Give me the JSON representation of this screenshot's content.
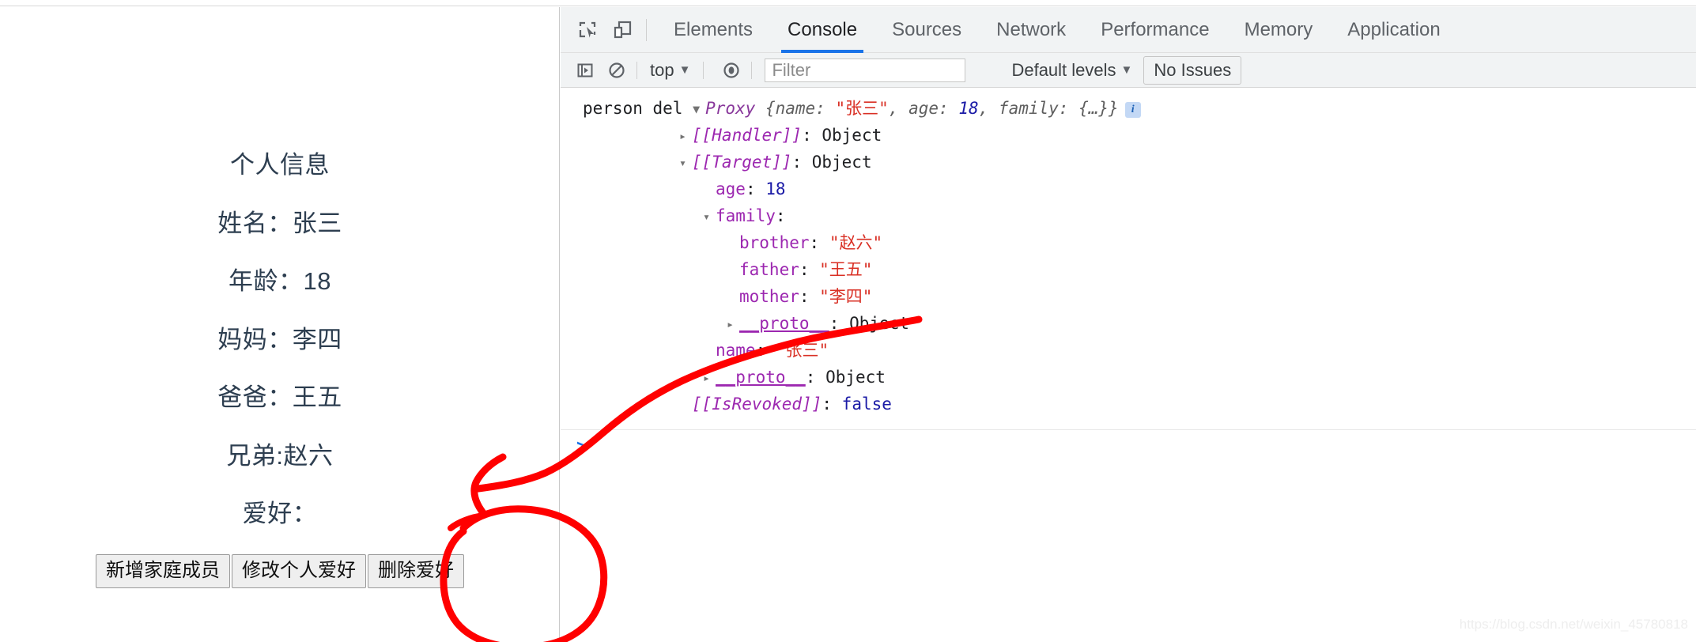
{
  "webpage": {
    "title": "个人信息",
    "lines": [
      {
        "key": "name",
        "text": "姓名：张三"
      },
      {
        "key": "age",
        "text": "年龄：18"
      },
      {
        "key": "mother",
        "text": "妈妈：李四"
      },
      {
        "key": "father",
        "text": "爸爸：王五"
      },
      {
        "key": "brother",
        "text": "兄弟:赵六"
      },
      {
        "key": "hobby",
        "text": "爱好："
      }
    ],
    "buttons": [
      {
        "name": "add-family-member-button",
        "label": "新增家庭成员"
      },
      {
        "name": "edit-hobby-button",
        "label": "修改个人爱好"
      },
      {
        "name": "delete-hobby-button",
        "label": "删除爱好"
      }
    ],
    "text_color": "#2d3e50"
  },
  "devtools": {
    "icons": {
      "inspect": "inspect-element-icon",
      "device": "device-toolbar-icon",
      "execute": "execute-snippet-icon",
      "clear": "clear-console-icon",
      "eye": "live-expression-icon"
    },
    "tabs": [
      {
        "label": "Elements",
        "active": false
      },
      {
        "label": "Console",
        "active": true
      },
      {
        "label": "Sources",
        "active": false
      },
      {
        "label": "Network",
        "active": false
      },
      {
        "label": "Performance",
        "active": false
      },
      {
        "label": "Memory",
        "active": false
      },
      {
        "label": "Application",
        "active": false
      }
    ],
    "active_tab_accent": "#1a73e8",
    "toolbar": {
      "context": "top",
      "filter_placeholder": "Filter",
      "filter_value": "",
      "levels": "Default levels",
      "issues": "No Issues"
    },
    "console": {
      "source_label": "person del",
      "summary": {
        "class": "Proxy",
        "open_brace": "{",
        "prop1_name": "name",
        "prop1_sep": ": ",
        "prop1_value": "\"张三\"",
        "comma1": ", ",
        "prop2_name": "age",
        "prop2_sep": ": ",
        "prop2_value": "18",
        "comma2": ", ",
        "prop3_name": "family",
        "prop3_sep": ": ",
        "prop3_value": "{…}",
        "close_brace": "}",
        "info_badge": "i"
      },
      "rows": [
        {
          "indent": 1,
          "tri": "right",
          "key": "[[Handler]]",
          "key_style": "propi",
          "sep": ": ",
          "value": "Object",
          "val_style": "plain"
        },
        {
          "indent": 1,
          "tri": "down",
          "key": "[[Target]]",
          "key_style": "propi",
          "sep": ": ",
          "value": "Object",
          "val_style": "plain"
        },
        {
          "indent": 2,
          "tri": "none",
          "key": "age",
          "key_style": "prop",
          "sep": ": ",
          "value": "18",
          "val_style": "num"
        },
        {
          "indent": 2,
          "tri": "down",
          "key": "family",
          "key_style": "prop",
          "sep": ":",
          "value": "",
          "val_style": "plain"
        },
        {
          "indent": 3,
          "tri": "none",
          "key": "brother",
          "key_style": "prop",
          "sep": ": ",
          "value": "\"赵六\"",
          "val_style": "str"
        },
        {
          "indent": 3,
          "tri": "none",
          "key": "father",
          "key_style": "prop",
          "sep": ": ",
          "value": "\"王五\"",
          "val_style": "str"
        },
        {
          "indent": 3,
          "tri": "none",
          "key": "mother",
          "key_style": "prop",
          "sep": ": ",
          "value": "\"李四\"",
          "val_style": "str"
        },
        {
          "indent": 3,
          "tri": "right",
          "key": "__proto__",
          "key_style": "proto",
          "sep": ": ",
          "value": "Object",
          "val_style": "plain"
        },
        {
          "indent": 2,
          "tri": "none",
          "key": "name",
          "key_style": "prop",
          "sep": ": ",
          "value": "\"张三\"",
          "val_style": "str"
        },
        {
          "indent": 2,
          "tri": "right",
          "key": "__proto__",
          "key_style": "proto",
          "sep": ": ",
          "value": "Object",
          "val_style": "plain"
        },
        {
          "indent": 1,
          "tri": "none",
          "key": "[[IsRevoked]]",
          "key_style": "propi",
          "sep": ": ",
          "value": "false",
          "val_style": "num"
        }
      ],
      "prompt": ">"
    }
  },
  "annotations": {
    "arrow_color": "#ff0000",
    "circle_color": "#ff0000",
    "arrow_name": "red-arrow-annotation",
    "circle_name": "red-circle-annotation"
  },
  "watermark": "https://blog.csdn.net/weixin_45780818"
}
